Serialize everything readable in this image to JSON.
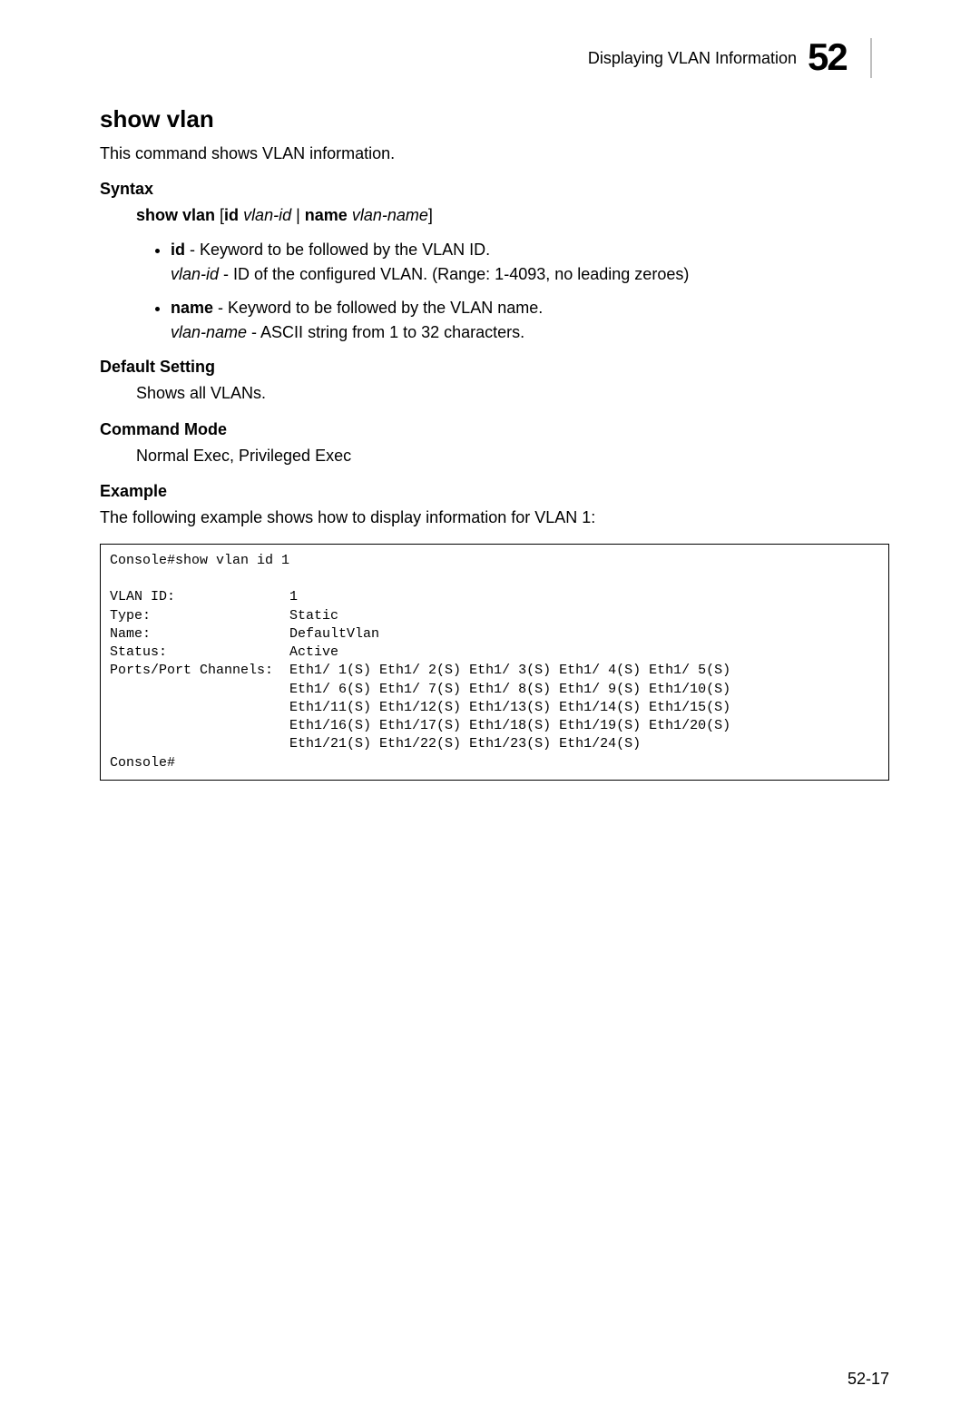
{
  "header": {
    "breadcrumb": "Displaying VLAN Information",
    "chapter": "52"
  },
  "title": "show vlan",
  "intro": "This command shows VLAN information.",
  "syntax": {
    "label": "Syntax",
    "cmd_bold1": "show vlan",
    "cmd_open": " [",
    "cmd_bold2": "id",
    "cmd_sp1": " ",
    "cmd_it1": "vlan-id",
    "cmd_mid": " | ",
    "cmd_bold3": "name",
    "cmd_sp2": " ",
    "cmd_it2": "vlan-name",
    "cmd_close": "]",
    "bullets": [
      {
        "kw": "id",
        "kw_desc": " - Keyword to be followed by the VLAN ID.",
        "param": "vlan-id",
        "param_desc": " - ID of the configured VLAN. (Range: 1-4093, no leading zeroes)"
      },
      {
        "kw": "name",
        "kw_desc": " - Keyword to be followed by the VLAN name.",
        "param": "vlan-name",
        "param_desc": " - ASCII string from 1 to 32 characters."
      }
    ]
  },
  "default_setting": {
    "label": "Default Setting",
    "text": "Shows all VLANs."
  },
  "command_mode": {
    "label": "Command Mode",
    "text": "Normal Exec, Privileged Exec"
  },
  "example": {
    "label": "Example",
    "text": "The following example shows how to display information for VLAN 1:",
    "code": "Console#show vlan id 1\n\nVLAN ID:              1\nType:                 Static\nName:                 DefaultVlan\nStatus:               Active\nPorts/Port Channels:  Eth1/ 1(S) Eth1/ 2(S) Eth1/ 3(S) Eth1/ 4(S) Eth1/ 5(S)\n                      Eth1/ 6(S) Eth1/ 7(S) Eth1/ 8(S) Eth1/ 9(S) Eth1/10(S)\n                      Eth1/11(S) Eth1/12(S) Eth1/13(S) Eth1/14(S) Eth1/15(S)\n                      Eth1/16(S) Eth1/17(S) Eth1/18(S) Eth1/19(S) Eth1/20(S)\n                      Eth1/21(S) Eth1/22(S) Eth1/23(S) Eth1/24(S)\nConsole#"
  },
  "footer": "52-17"
}
